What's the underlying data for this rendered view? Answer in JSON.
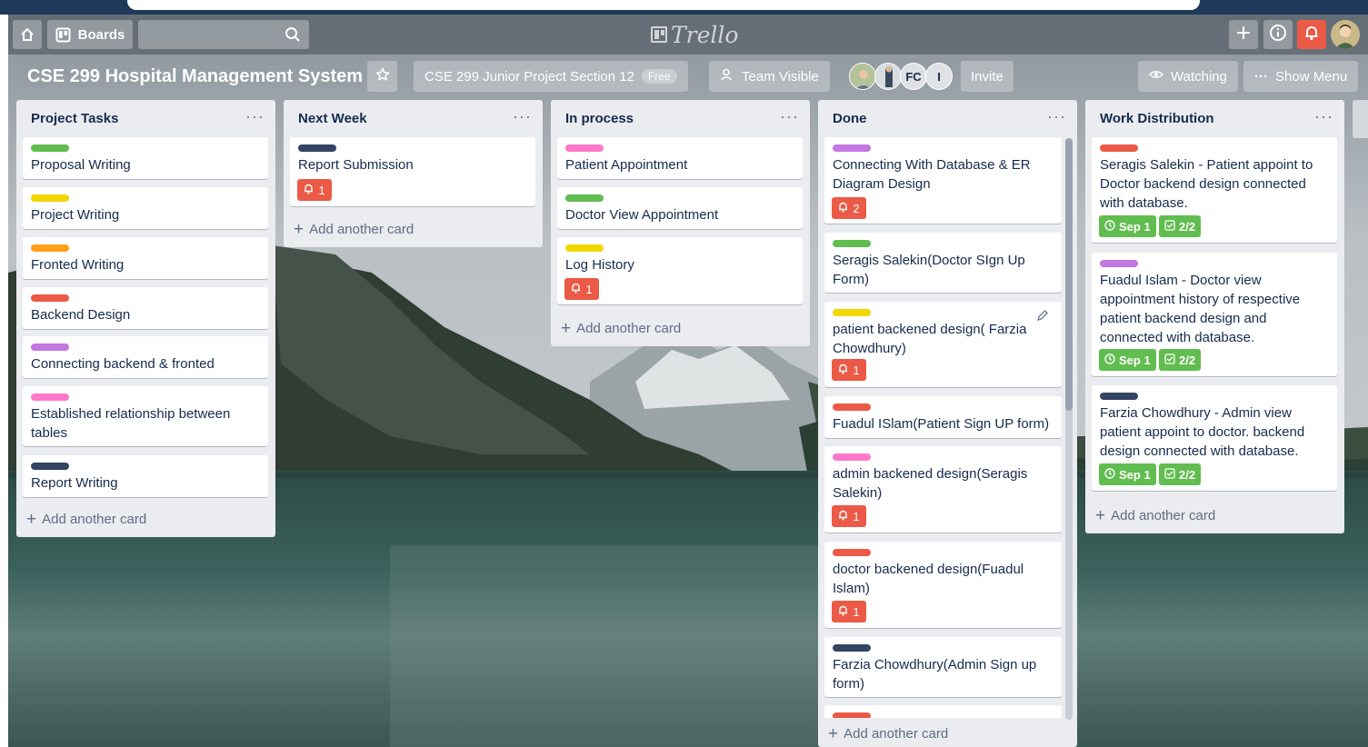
{
  "header": {
    "boards_label": "Boards",
    "logo_text": "Trello"
  },
  "board": {
    "title": "CSE 299 Hospital Management System",
    "team_name": "CSE 299 Junior Project Section 12",
    "plan_badge": "Free",
    "visibility": "Team Visible",
    "member_initials": [
      "FC",
      "I"
    ],
    "invite_label": "Invite",
    "watching_label": "Watching",
    "show_menu_label": "Show Menu"
  },
  "lists": [
    {
      "title": "Project Tasks",
      "add_label": "Add another card",
      "cards": [
        {
          "title": "Proposal Writing",
          "label_color": "#61bd4f"
        },
        {
          "title": "Project Writing",
          "label_color": "#f2d600"
        },
        {
          "title": "Fronted Writing",
          "label_color": "#ff9f1a"
        },
        {
          "title": "Backend Design",
          "label_color": "#eb5a46"
        },
        {
          "title": "Connecting backend & fronted",
          "label_color": "#c377e0"
        },
        {
          "title": "Established relationship between tables",
          "label_color": "#ff78cb"
        },
        {
          "title": "Report Writing",
          "label_color": "#344563"
        }
      ]
    },
    {
      "title": "Next Week",
      "add_label": "Add another card",
      "cards": [
        {
          "title": "Report Submission",
          "label_color": "#344563",
          "notifications": "1"
        }
      ]
    },
    {
      "title": "In process",
      "add_label": "Add another card",
      "cards": [
        {
          "title": "Patient Appointment",
          "label_color": "#ff78cb"
        },
        {
          "title": "Doctor View Appointment",
          "label_color": "#61bd4f"
        },
        {
          "title": "Log History",
          "label_color": "#f2d600",
          "notifications": "1"
        }
      ]
    },
    {
      "title": "Done",
      "add_label": "Add another card",
      "cards": [
        {
          "title": "Connecting With Database & ER Diagram Design",
          "label_color": "#c377e0",
          "notifications": "2"
        },
        {
          "title": "Seragis Salekin(Doctor SIgn Up Form)",
          "label_color": "#61bd4f"
        },
        {
          "title": "patient backened design( Farzia Chowdhury)",
          "label_color": "#f2d600",
          "notifications": "1"
        },
        {
          "title": "Fuadul ISlam(Patient Sign UP form)",
          "label_color": "#eb5a46"
        },
        {
          "title": "admin backened design(Seragis Salekin)",
          "label_color": "#ff78cb",
          "notifications": "1"
        },
        {
          "title": "doctor backened design(Fuadul Islam)",
          "label_color": "#eb5a46",
          "notifications": "1"
        },
        {
          "title": "Farzia Chowdhury(Admin Sign up form)",
          "label_color": "#344563"
        }
      ]
    },
    {
      "title": "Work Distribution",
      "add_label": "Add another card",
      "cards": [
        {
          "title": "Seragis Salekin - Patient appoint to Doctor backend design connected with database.",
          "label_color": "#eb5a46",
          "due": "Sep 1",
          "checklist": "2/2"
        },
        {
          "title": "Fuadul Islam - Doctor view appointment history of respective patient backend design and connected with database.",
          "label_color": "#c377e0",
          "due": "Sep 1",
          "checklist": "2/2"
        },
        {
          "title": "Farzia Chowdhury - Admin view patient appoint to doctor. backend design connected with database.",
          "label_color": "#344563",
          "due": "Sep 1",
          "checklist": "2/2"
        }
      ]
    }
  ]
}
